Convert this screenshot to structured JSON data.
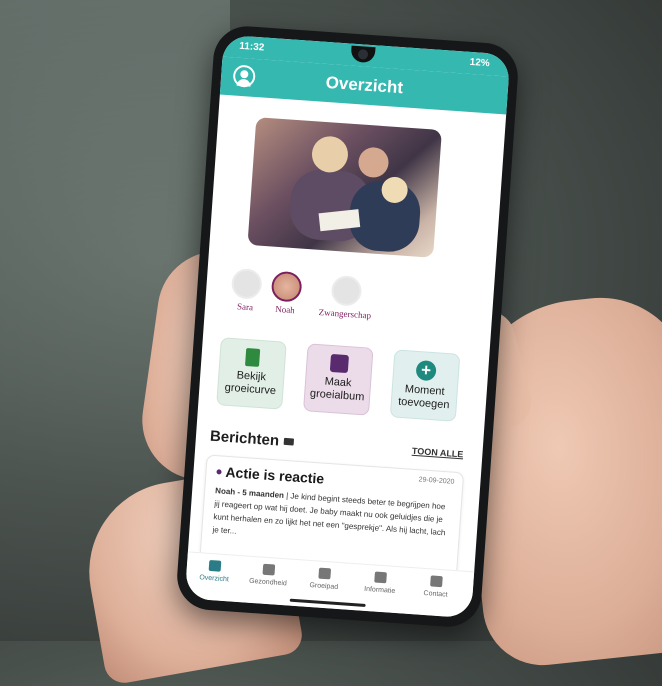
{
  "status_bar": {
    "time": "11:32",
    "battery": "12%"
  },
  "app_bar": {
    "title": "Overzicht"
  },
  "profiles": [
    {
      "name": "Sara",
      "active": false
    },
    {
      "name": "Noah",
      "active": true
    },
    {
      "name": "Zwangerschap",
      "active": false
    }
  ],
  "tiles": [
    {
      "label_line1": "Bekijk",
      "label_line2": "groeicurve",
      "icon": "growth-chart-icon"
    },
    {
      "label_line1": "Maak",
      "label_line2": "groeialbum",
      "icon": "album-icon"
    },
    {
      "label_line1": "Moment",
      "label_line2": "toevoegen",
      "icon": "plus-icon"
    }
  ],
  "messages": {
    "heading": "Berichten",
    "show_all": "TOON ALLE",
    "items": [
      {
        "title": "Actie is reactie",
        "date": "29-09-2020",
        "meta": "Noah - 5 maanden",
        "text": " | Je kind begint steeds beter te begrijpen hoe jij reageert op wat hij doet. Je baby maakt nu ook geluidjes die je kunt herhalen en zo lijkt het net een \"gesprekje\". Als hij lacht, lach je ter..."
      }
    ]
  },
  "bottom_nav": [
    {
      "label": "Overzicht",
      "active": true
    },
    {
      "label": "Gezondheid",
      "active": false
    },
    {
      "label": "Groeipad",
      "active": false
    },
    {
      "label": "Informatie",
      "active": false
    },
    {
      "label": "Contact",
      "active": false
    }
  ],
  "colors": {
    "accent": "#34b8b0",
    "brand_purple": "#7e1f5d",
    "nav_active": "#2a7d86"
  }
}
